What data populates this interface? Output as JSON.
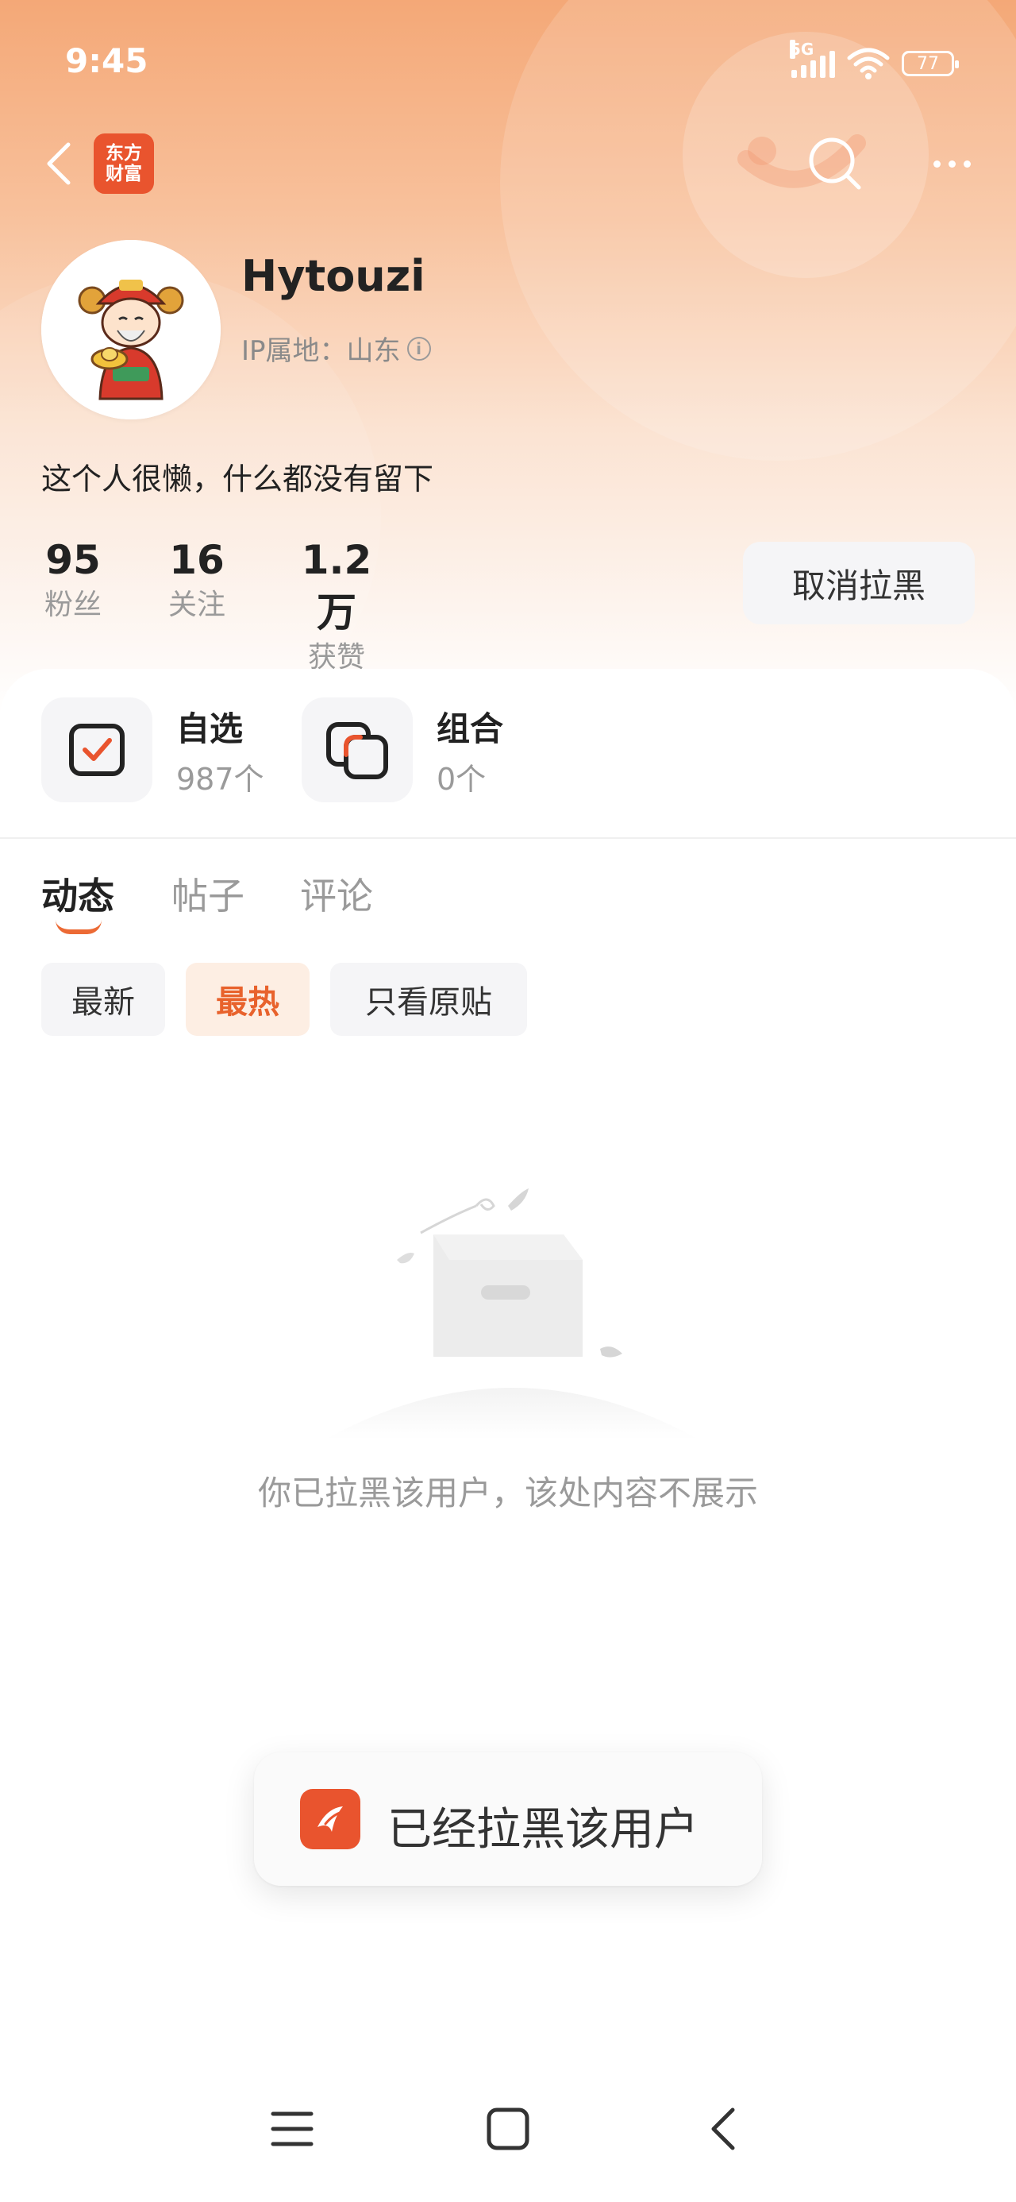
{
  "status_bar": {
    "time": "9:45",
    "network": "5G",
    "battery": "77"
  },
  "topnav": {
    "logo_line1": "东方",
    "logo_line2": "财富"
  },
  "profile": {
    "username": "Hytouzi",
    "ip_location": "IP属地：山东",
    "bio": "这个人很懒，什么都没有留下"
  },
  "stats": [
    {
      "value": "95",
      "label": "粉丝"
    },
    {
      "value": "16",
      "label": "关注"
    },
    {
      "value": "1.2万",
      "label": "获赞"
    }
  ],
  "unblock_button": "取消拉黑",
  "features": [
    {
      "title": "自选",
      "subtitle": "987个"
    },
    {
      "title": "组合",
      "subtitle": "0个"
    }
  ],
  "tabs": [
    {
      "label": "动态",
      "active": true
    },
    {
      "label": "帖子",
      "active": false
    },
    {
      "label": "评论",
      "active": false
    }
  ],
  "filters": [
    {
      "label": "最新",
      "active": false
    },
    {
      "label": "最热",
      "active": true
    },
    {
      "label": "只看原贴",
      "active": false
    }
  ],
  "empty_state": {
    "message": "你已拉黑该用户，该处内容不展示"
  },
  "toast": {
    "message": "已经拉黑该用户"
  },
  "colors": {
    "accent": "#e9542e",
    "tab_underline": "#ec6a35",
    "chip_active_bg": "#fdeee3"
  }
}
